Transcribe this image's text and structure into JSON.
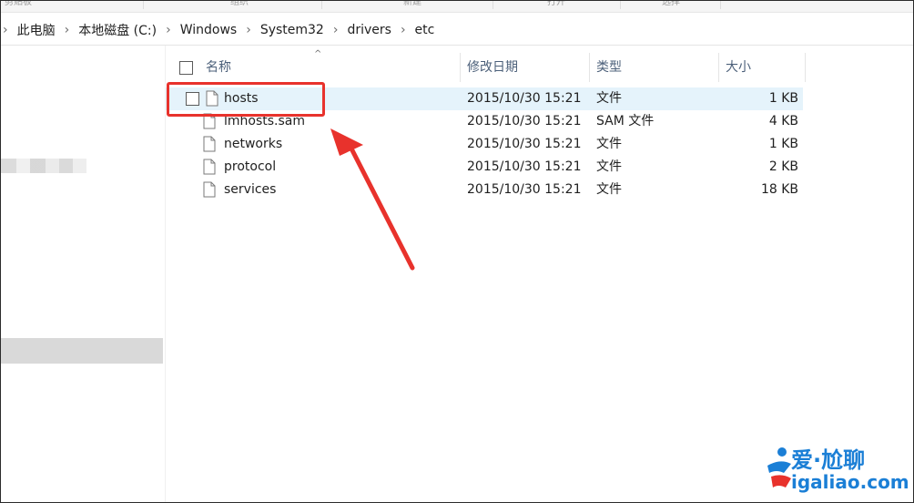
{
  "ribbon": {
    "labels": [
      "剪贴板",
      "组织",
      "新建",
      "打开",
      "选择"
    ]
  },
  "address": {
    "crumbs": [
      "此电脑",
      "本地磁盘 (C:)",
      "Windows",
      "System32",
      "drivers",
      "etc"
    ]
  },
  "columns": {
    "name": "名称",
    "modified": "修改日期",
    "type": "类型",
    "size": "大小"
  },
  "files": [
    {
      "name": "hosts",
      "modified": "2015/10/30 15:21",
      "type": "文件",
      "size": "1 KB"
    },
    {
      "name": "lmhosts.sam",
      "modified": "2015/10/30 15:21",
      "type": "SAM 文件",
      "size": "4 KB"
    },
    {
      "name": "networks",
      "modified": "2015/10/30 15:21",
      "type": "文件",
      "size": "1 KB"
    },
    {
      "name": "protocol",
      "modified": "2015/10/30 15:21",
      "type": "文件",
      "size": "2 KB"
    },
    {
      "name": "services",
      "modified": "2015/10/30 15:21",
      "type": "文件",
      "size": "18 KB"
    }
  ],
  "watermark": {
    "brand": "爱·尬聊",
    "url": "igaliao.com"
  },
  "colors": {
    "highlight": "#e8322c",
    "hover_row": "#e5f3fb",
    "header_text": "#4c607a",
    "watermark": "#1b7fd6"
  }
}
